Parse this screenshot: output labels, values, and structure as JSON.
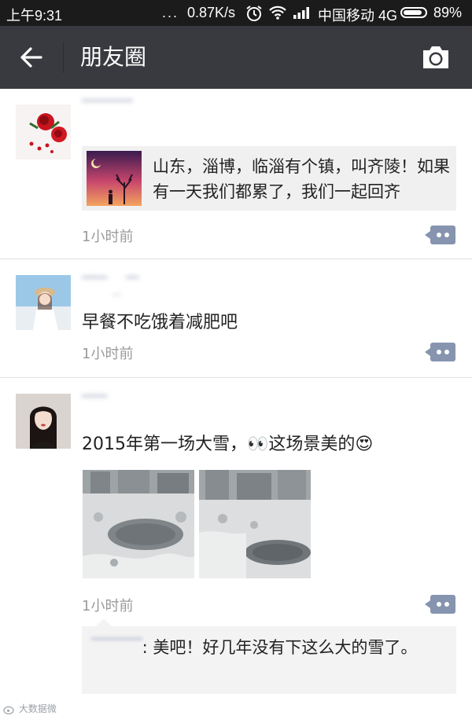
{
  "status_bar": {
    "time": "上午9:31",
    "dots": "...",
    "net_speed": "0.87K/s",
    "carrier": "中国移动 4G",
    "battery_percent": "89%",
    "battery_level": 0.89
  },
  "header": {
    "title": "朋友圈",
    "back_icon": "arrow-left-icon",
    "camera_icon": "camera-icon"
  },
  "posts": [
    {
      "username": "▔▔▔▔",
      "share_text": "山东，淄博，临淄有个镇，叫齐陵！如果有一天我们都累了，我们一起回齐",
      "time": "1小时前"
    },
    {
      "username": "▔▔ _ ▔",
      "text": "早餐不吃饿着减肥吧",
      "time": "1小时前"
    },
    {
      "username": "▔▔",
      "text": "2015年第一场大雪，👀这场景美的😍",
      "time": "1小时前",
      "comment": {
        "author": "▔▔▔▔",
        "text": ": 美吧！好几年没有下这么大的雪了。"
      }
    }
  ],
  "watermark": "大数据微"
}
